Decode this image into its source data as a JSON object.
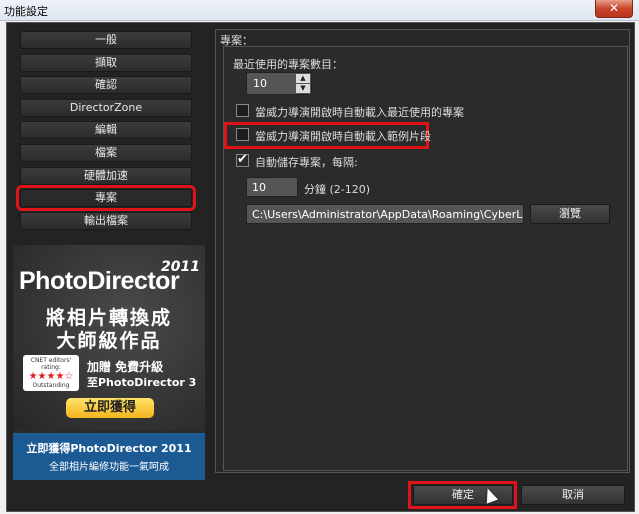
{
  "window": {
    "title": "功能設定",
    "close_label": "✕"
  },
  "sidebar": {
    "items": [
      {
        "label": "一般"
      },
      {
        "label": "擷取"
      },
      {
        "label": "確認"
      },
      {
        "label": "DirectorZone"
      },
      {
        "label": "編輯"
      },
      {
        "label": "檔案"
      },
      {
        "label": "硬體加速"
      },
      {
        "label": "專案"
      },
      {
        "label": "輸出檔案"
      }
    ],
    "active_index": 7
  },
  "ad": {
    "logo": "PhotoDirector",
    "year": "2011",
    "headline1": "將相片轉換成",
    "headline2": "大師級作品",
    "badge_text": "CNET editors' rating:",
    "badge_stars": "★★★★☆",
    "badge_sub": "Outstanding",
    "gift": "加贈 免費升級",
    "upgrade": "至PhotoDirector 3",
    "cta": "立即獲得",
    "bottom_line1": "立即獲得PhotoDirector 2011",
    "bottom_line2": "全部相片編修功能一氣呵成"
  },
  "panel": {
    "title": "專案：",
    "recent_count_label": "最近使用的專案數目：",
    "recent_count_value": "10",
    "opt_load_recent": "當威力導演開啟時自動載入最近使用的專案",
    "opt_load_recent_checked": false,
    "opt_load_sample": "當威力導演開啟時自動載入範例片段",
    "opt_load_sample_checked": false,
    "opt_autosave": "自動儲存專案，每隔:",
    "opt_autosave_checked": true,
    "autosave_minutes": "10",
    "autosave_unit": "分鐘 (2-120)",
    "path_value": "C:\\Users\\Administrator\\AppData\\Roaming\\CyberLink\\Po",
    "browse_label": "瀏覽"
  },
  "footer": {
    "ok_label": "確定",
    "cancel_label": "取消"
  },
  "colors": {
    "highlight": "#e0131a",
    "dialog_bg": "#232323"
  }
}
